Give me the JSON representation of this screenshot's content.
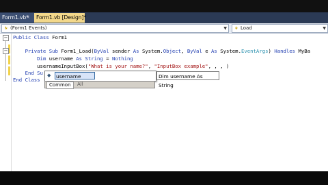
{
  "tabs": [
    {
      "label": "Form1.vb*",
      "close": "×"
    },
    {
      "label": "Form1.vb [Design]*"
    }
  ],
  "dropdowns": {
    "left": "(Form1 Events)",
    "right": "Load"
  },
  "code_lines": [
    {
      "id": "l1",
      "text": "Public Class Form1"
    },
    {
      "id": "l2",
      "text": ""
    },
    {
      "id": "l3",
      "text": "    Private Sub Form1_Load(ByVal sender As System.Object, ByVal e As System.EventArgs) Handles MyBa"
    },
    {
      "id": "l4",
      "text": "        Dim username As String = Nothing"
    },
    {
      "id": "l5",
      "text": "        usernameInputBox(\"What is your name?\", \"InputBox example\", , , )"
    },
    {
      "id": "l6",
      "text": "    End Sub"
    },
    {
      "id": "l7",
      "text": "End Class"
    }
  ],
  "intellisense": {
    "selected_item": "username",
    "tooltip": "Dim username As String",
    "tab_common": "Common",
    "tab_all": "All"
  },
  "colors": {
    "keyword": "#1f3cb0",
    "string": "#a31515",
    "type": "#2b91af",
    "tab_active": "#f3d88b",
    "tabstrip": "#2b3a55"
  }
}
